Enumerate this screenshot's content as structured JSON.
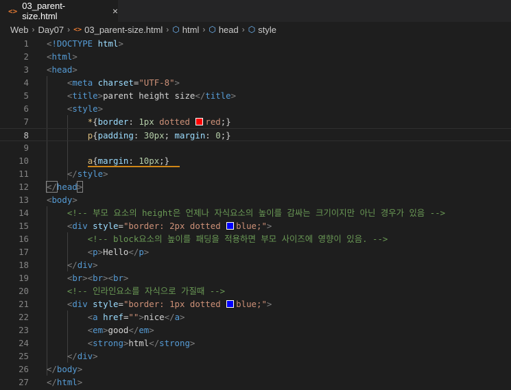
{
  "tab": {
    "icon": "code-brackets-icon",
    "label": "03_parent-size.html",
    "close": "×"
  },
  "breadcrumb": [
    "Web",
    "Day07",
    "03_parent-size.html",
    "html",
    "head",
    "style"
  ],
  "swatch_colors": {
    "red": "#ff0000",
    "blue": "#0000ff"
  },
  "lines": [
    [
      [
        "p",
        "<"
      ],
      [
        "t",
        "!DOCTYPE"
      ],
      [
        "d",
        " "
      ],
      [
        "a",
        "html"
      ],
      [
        "p",
        ">"
      ]
    ],
    [
      [
        "p",
        "<"
      ],
      [
        "t",
        "html"
      ],
      [
        "p",
        ">"
      ]
    ],
    [
      [
        "p",
        "<"
      ],
      [
        "t",
        "head"
      ],
      [
        "p",
        ">"
      ]
    ],
    [
      [
        "d",
        "    "
      ],
      [
        "p",
        "<"
      ],
      [
        "t",
        "meta"
      ],
      [
        "d",
        " "
      ],
      [
        "a",
        "charset"
      ],
      [
        "d",
        "="
      ],
      [
        "s",
        "\"UTF-8\""
      ],
      [
        "p",
        ">"
      ]
    ],
    [
      [
        "d",
        "    "
      ],
      [
        "p",
        "<"
      ],
      [
        "t",
        "title"
      ],
      [
        "p",
        ">"
      ],
      [
        "d",
        "parent height size"
      ],
      [
        "p",
        "</"
      ],
      [
        "t",
        "title"
      ],
      [
        "p",
        ">"
      ]
    ],
    [
      [
        "d",
        "    "
      ],
      [
        "p",
        "<"
      ],
      [
        "t",
        "style"
      ],
      [
        "p",
        ">"
      ]
    ],
    [
      [
        "d",
        "        "
      ],
      [
        "sel",
        "*"
      ],
      [
        "d",
        "{"
      ],
      [
        "a",
        "border"
      ],
      [
        "d",
        ": "
      ],
      [
        "n",
        "1px"
      ],
      [
        "d",
        " "
      ],
      [
        "s",
        "dotted "
      ],
      [
        "sw",
        "red"
      ],
      [
        "s",
        "red"
      ],
      [
        "d",
        ";}"
      ]
    ],
    [
      [
        "d",
        "        "
      ],
      [
        "sel",
        "p"
      ],
      [
        "d",
        "{"
      ],
      [
        "a",
        "padding"
      ],
      [
        "d",
        ": "
      ],
      [
        "n",
        "30px"
      ],
      [
        "d",
        "; "
      ],
      [
        "a",
        "margin"
      ],
      [
        "d",
        ": "
      ],
      [
        "n",
        "0"
      ],
      [
        "d",
        ";}"
      ]
    ],
    [],
    [
      [
        "d",
        "        "
      ],
      [
        "sel",
        "a"
      ],
      [
        "d",
        "{"
      ],
      [
        "a",
        "margin"
      ],
      [
        "d",
        ": "
      ],
      [
        "n",
        "10px"
      ],
      [
        "d",
        ";}"
      ]
    ],
    [
      [
        "d",
        "    "
      ],
      [
        "p",
        "</"
      ],
      [
        "t",
        "style"
      ],
      [
        "p",
        ">"
      ]
    ],
    [
      [
        "bmp",
        "</"
      ],
      [
        "t",
        "head"
      ],
      [
        "bmp",
        ">"
      ]
    ],
    [
      [
        "p",
        "<"
      ],
      [
        "t",
        "body"
      ],
      [
        "p",
        ">"
      ]
    ],
    [
      [
        "d",
        "    "
      ],
      [
        "c",
        "<!-- 부모 요소의 height은 언제나 자식요소의 높이를 감싸는 크기이지만 아닌 경우가 있음 -->"
      ]
    ],
    [
      [
        "d",
        "    "
      ],
      [
        "p",
        "<"
      ],
      [
        "t",
        "div"
      ],
      [
        "d",
        " "
      ],
      [
        "a",
        "style"
      ],
      [
        "d",
        "="
      ],
      [
        "s",
        "\"border: 2px dotted "
      ],
      [
        "sw",
        "blue"
      ],
      [
        "s",
        "blue;\""
      ],
      [
        "p",
        ">"
      ]
    ],
    [
      [
        "d",
        "        "
      ],
      [
        "c",
        "<!-- block요소의 높이를 패딩을 적용하면 부모 사이즈에 영향이 있음. -->"
      ]
    ],
    [
      [
        "d",
        "        "
      ],
      [
        "p",
        "<"
      ],
      [
        "t",
        "p"
      ],
      [
        "p",
        ">"
      ],
      [
        "d",
        "Hello"
      ],
      [
        "p",
        "</"
      ],
      [
        "t",
        "p"
      ],
      [
        "p",
        ">"
      ]
    ],
    [
      [
        "d",
        "    "
      ],
      [
        "p",
        "</"
      ],
      [
        "t",
        "div"
      ],
      [
        "p",
        ">"
      ]
    ],
    [
      [
        "d",
        "    "
      ],
      [
        "p",
        "<"
      ],
      [
        "t",
        "br"
      ],
      [
        "p",
        "><"
      ],
      [
        "t",
        "br"
      ],
      [
        "p",
        "><"
      ],
      [
        "t",
        "br"
      ],
      [
        "p",
        ">"
      ]
    ],
    [
      [
        "d",
        "    "
      ],
      [
        "c",
        "<!-- 인라인요소를 자식으로 가질때 -->"
      ]
    ],
    [
      [
        "d",
        "    "
      ],
      [
        "p",
        "<"
      ],
      [
        "t",
        "div"
      ],
      [
        "d",
        " "
      ],
      [
        "a",
        "style"
      ],
      [
        "d",
        "="
      ],
      [
        "s",
        "\"border: 1px dotted "
      ],
      [
        "sw",
        "blue"
      ],
      [
        "s",
        "blue;\""
      ],
      [
        "p",
        ">"
      ]
    ],
    [
      [
        "d",
        "        "
      ],
      [
        "p",
        "<"
      ],
      [
        "t",
        "a"
      ],
      [
        "d",
        " "
      ],
      [
        "a",
        "href"
      ],
      [
        "d",
        "="
      ],
      [
        "s",
        "\"\""
      ],
      [
        "p",
        ">"
      ],
      [
        "d",
        "nice"
      ],
      [
        "p",
        "</"
      ],
      [
        "t",
        "a"
      ],
      [
        "p",
        ">"
      ]
    ],
    [
      [
        "d",
        "        "
      ],
      [
        "p",
        "<"
      ],
      [
        "t",
        "em"
      ],
      [
        "p",
        ">"
      ],
      [
        "d",
        "good"
      ],
      [
        "p",
        "</"
      ],
      [
        "t",
        "em"
      ],
      [
        "p",
        ">"
      ]
    ],
    [
      [
        "d",
        "        "
      ],
      [
        "p",
        "<"
      ],
      [
        "t",
        "strong"
      ],
      [
        "p",
        ">"
      ],
      [
        "d",
        "html"
      ],
      [
        "p",
        "</"
      ],
      [
        "t",
        "strong"
      ],
      [
        "p",
        ">"
      ]
    ],
    [
      [
        "d",
        "    "
      ],
      [
        "p",
        "</"
      ],
      [
        "t",
        "div"
      ],
      [
        "p",
        ">"
      ]
    ],
    [
      [
        "p",
        "</"
      ],
      [
        "t",
        "body"
      ],
      [
        "p",
        ">"
      ]
    ],
    [
      [
        "p",
        "</"
      ],
      [
        "t",
        "html"
      ],
      [
        "p",
        ">"
      ]
    ]
  ],
  "line_numbers": [
    "1",
    "2",
    "3",
    "4",
    "5",
    "6",
    "7",
    "8",
    "9",
    "10",
    "11",
    "12",
    "13",
    "14",
    "15",
    "16",
    "17",
    "18",
    "19",
    "20",
    "21",
    "22",
    "23",
    "24",
    "25",
    "26",
    "27"
  ],
  "current_line": 8
}
